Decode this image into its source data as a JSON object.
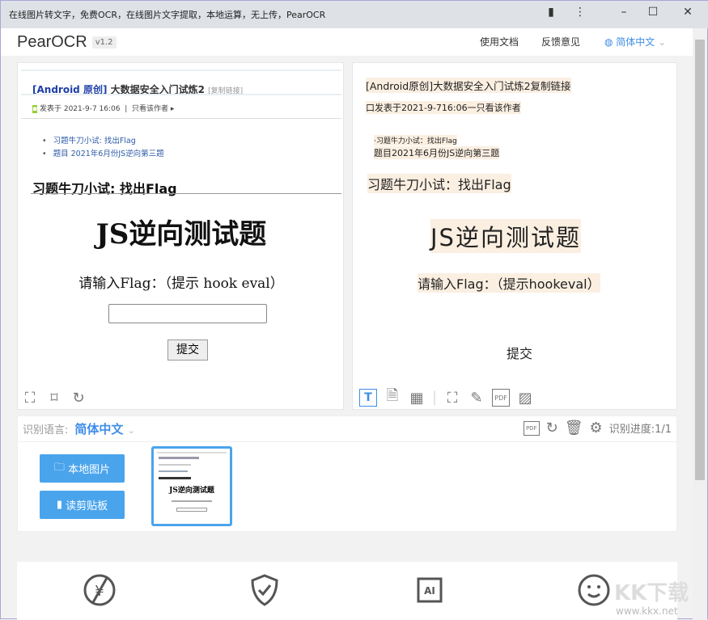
{
  "window": {
    "title": "在线图片转文字，免费OCR，在线图片文字提取，本地运算，无上传，PearOCR",
    "controls": [
      "clipboard",
      "more",
      "minimize",
      "maximize",
      "close"
    ]
  },
  "header": {
    "logo": "PearOCR",
    "version": "v1.2",
    "docs": "使用文档",
    "feedback": "反馈意见",
    "language": "简体中文"
  },
  "source": {
    "title_prefix": "[Android 原创]",
    "title": "大数据安全入门试炼2",
    "copy_link": "[复制链接]",
    "posted": "发表于 2021-9-7 16:06",
    "author_only": "只看该作者",
    "list": [
      "习题牛刀小试: 找出Flag",
      "题目 2021年6月份JS逆向第三题"
    ],
    "h2": "习题牛刀小试: 找出Flag",
    "h1": "JS逆向测试题",
    "prompt": "请输入Flag：（提示 hook eval）",
    "submit": "提交"
  },
  "ocr": {
    "lines": [
      "[Android原创]大数据安全入门试炼2复制链接",
      "口发表于2021-9-716:06一只看该作者",
      "·习题牛力小试：找出Flag",
      "题目2021年6月份JS逆向第三题",
      "习题牛刀小试：找出Flag",
      "JS逆向测试题",
      "请输入Flag：（提示hookeval）",
      "提交"
    ]
  },
  "lang_bar": {
    "label": "识别语言:",
    "selected": "简体中文",
    "progress": "识别进度:1/1"
  },
  "buttons": {
    "local": "本地图片",
    "clipboard": "读剪贴板"
  },
  "thumb": {
    "h1": "JS逆向测试题"
  },
  "watermark": {
    "text": "KK下载",
    "url": "www.kkx.net"
  },
  "accent": "#4aa4ec"
}
